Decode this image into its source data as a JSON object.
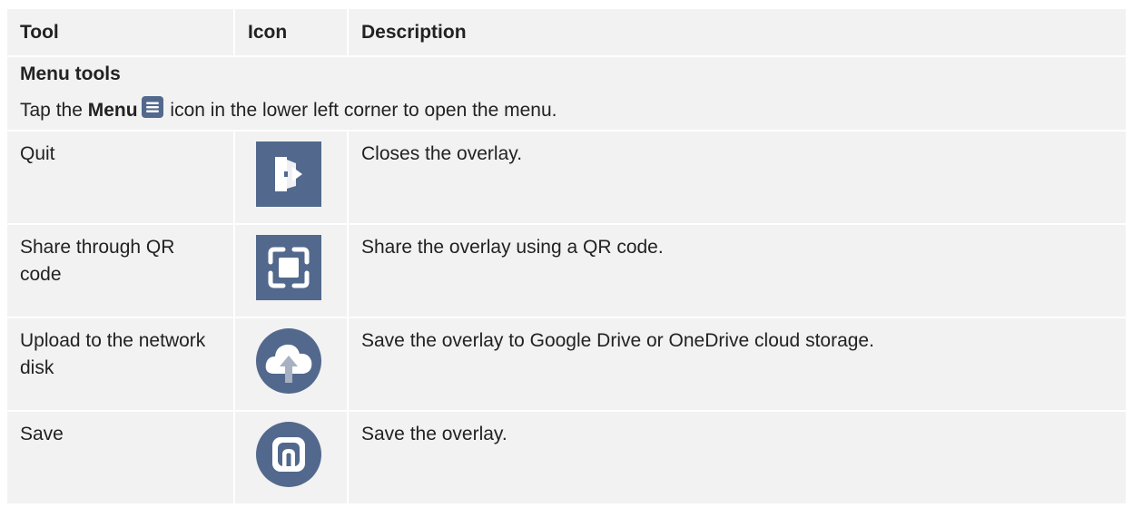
{
  "table": {
    "headers": {
      "tool": "Tool",
      "icon": "Icon",
      "description": "Description"
    },
    "section": {
      "title": "Menu tools",
      "note_prefix": "Tap the ",
      "note_bold": "Menu",
      "note_icon": "menu-icon",
      "note_suffix": " icon in the lower left corner to open the menu."
    },
    "rows": [
      {
        "tool": "Quit",
        "icon": "exit-door-icon",
        "description": "Closes the overlay."
      },
      {
        "tool": "Share through QR code",
        "icon": "qr-scan-icon",
        "description": "Share the overlay using a QR code."
      },
      {
        "tool": "Upload to the network disk",
        "icon": "cloud-upload-icon",
        "description": "Save the overlay to Google Drive or OneDrive cloud storage."
      },
      {
        "tool": "Save",
        "icon": "save-icon",
        "description": "Save the overlay."
      }
    ]
  },
  "colors": {
    "row_background": "#f2f2f2",
    "icon_background": "#52698d",
    "icon_foreground": "#ffffff",
    "text": "#222222"
  }
}
